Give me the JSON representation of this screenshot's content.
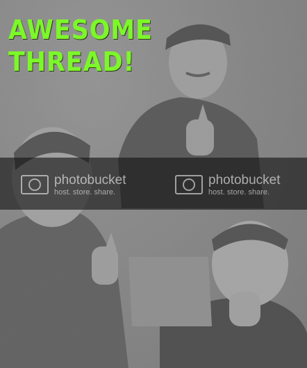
{
  "image": {
    "headline": "AWESOME\nTHREAD!",
    "watermark": {
      "brand": "photobucket",
      "tagline": "host. store. share."
    }
  },
  "colors": {
    "headline": "#7cf72a",
    "band": "#1e1e1e"
  },
  "icons": [
    "camera-frame-icon"
  ]
}
